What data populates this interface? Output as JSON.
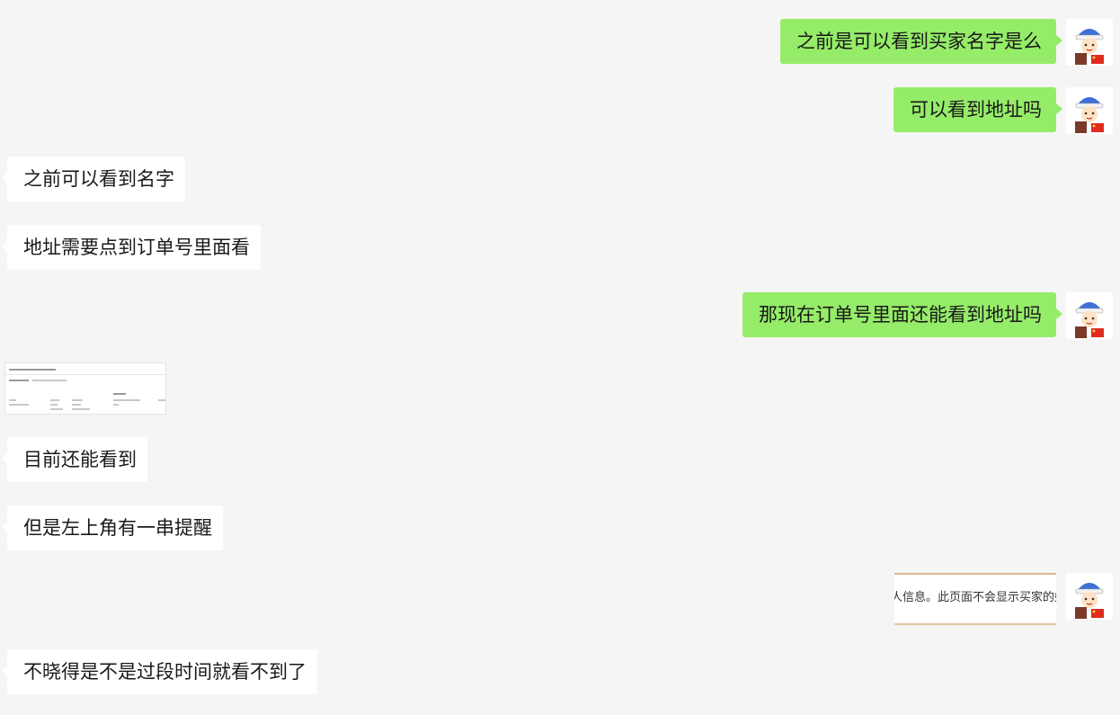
{
  "messages": [
    {
      "side": "me",
      "text": "之前是可以看到买家名字是么"
    },
    {
      "side": "me",
      "text": "可以看到地址吗"
    },
    {
      "side": "them",
      "text": "之前可以看到名字"
    },
    {
      "side": "them",
      "text": "地址需要点到订单号里面看"
    },
    {
      "side": "me",
      "text": "那现在订单号里面还能看到地址吗"
    },
    {
      "side": "them",
      "type": "image",
      "image_name": "order-page-screenshot"
    },
    {
      "side": "them",
      "text": "目前还能看到"
    },
    {
      "side": "them",
      "text": "但是左上角有一串提醒"
    },
    {
      "side": "me",
      "type": "image",
      "image_name": "notice-screenshot",
      "caption": "人信息。此页面不会显示买家的姓名"
    },
    {
      "side": "them",
      "text": "不晓得是不是过段时间就看不到了"
    }
  ],
  "avatar": {
    "icon": "cartoon-boy-blue-hat-avatar"
  },
  "colors": {
    "background": "#f5f5f5",
    "my_bubble": "#95ec69",
    "their_bubble": "#ffffff"
  }
}
